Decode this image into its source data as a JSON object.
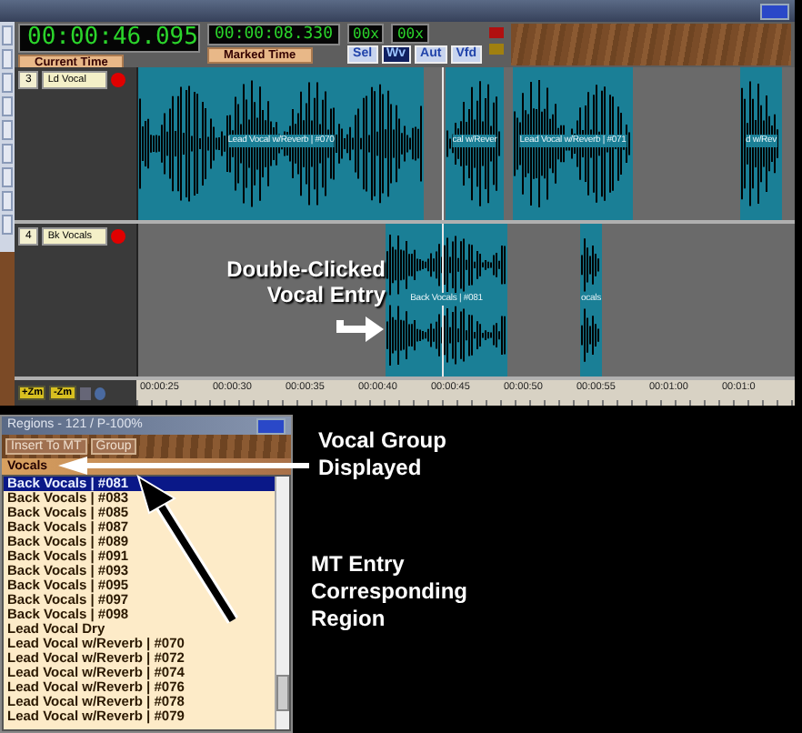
{
  "toolbar": {
    "current_time": "00:00:46.095",
    "current_time_label": "Current Time",
    "marked_time": "00:00:08.330",
    "marked_time_label": "Marked Time",
    "counters": [
      "00x",
      "00x"
    ],
    "view_buttons": [
      {
        "label": "Sel",
        "selected": false
      },
      {
        "label": "Wv",
        "selected": true
      },
      {
        "label": "Aut",
        "selected": false
      },
      {
        "label": "Vfd",
        "selected": false
      }
    ]
  },
  "tracks": [
    {
      "number": "3",
      "name": "Ld Vocal",
      "clips": [
        {
          "label": "Lead Vocal w/Reverb | #070"
        },
        {
          "label": "cal w/Rever"
        },
        {
          "label": "Lead Vocal w/Reverb | #071"
        },
        {
          "label": "d w/Rev"
        }
      ]
    },
    {
      "number": "4",
      "name": "Bk Vocals",
      "clips": [
        {
          "label": "Back Vocals | #081"
        },
        {
          "label": "ocals"
        }
      ]
    }
  ],
  "zoom_buttons": [
    "+Zm",
    "-Zm"
  ],
  "ruler": [
    "00:00:25",
    "00:00:30",
    "00:00:35",
    "00:00:40",
    "00:00:45",
    "00:00:50",
    "00:00:55",
    "00:01:00",
    "00:01:0"
  ],
  "regions_window": {
    "title": "Regions - 121 / P-100%",
    "buttons": [
      "Insert To MT",
      "Group"
    ],
    "group": "Vocals",
    "items": [
      {
        "label": "Back Vocals | #081",
        "selected": true
      },
      {
        "label": "Back Vocals | #083",
        "selected": false
      },
      {
        "label": "Back Vocals | #085",
        "selected": false
      },
      {
        "label": "Back Vocals | #087",
        "selected": false
      },
      {
        "label": "Back Vocals | #089",
        "selected": false
      },
      {
        "label": "Back Vocals | #091",
        "selected": false
      },
      {
        "label": "Back Vocals | #093",
        "selected": false
      },
      {
        "label": "Back Vocals | #095",
        "selected": false
      },
      {
        "label": "Back Vocals | #097",
        "selected": false
      },
      {
        "label": "Back Vocals | #098",
        "selected": false
      },
      {
        "label": "Lead Vocal Dry",
        "selected": false
      },
      {
        "label": "Lead Vocal w/Reverb | #070",
        "selected": false
      },
      {
        "label": "Lead Vocal w/Reverb | #072",
        "selected": false
      },
      {
        "label": "Lead Vocal w/Reverb | #074",
        "selected": false
      },
      {
        "label": "Lead Vocal w/Reverb | #076",
        "selected": false
      },
      {
        "label": "Lead Vocal w/Reverb | #078",
        "selected": false
      },
      {
        "label": "Lead Vocal w/Reverb | #079",
        "selected": false
      }
    ]
  },
  "callouts": {
    "double_clicked": "Double-Clicked Vocal Entry",
    "group_displayed": "Vocal Group Displayed",
    "mt_entry": "MT Entry Corresponding Region"
  }
}
